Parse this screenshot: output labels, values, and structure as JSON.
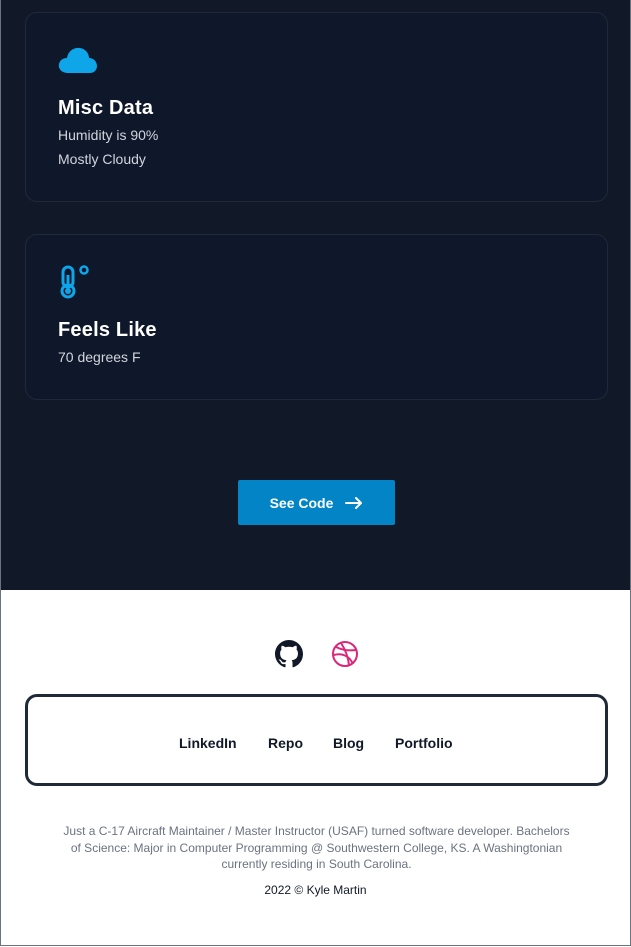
{
  "cards": [
    {
      "icon": "cloud-icon",
      "title": "Misc Data",
      "lines": [
        "Humidity is 90%",
        "Mostly Cloudy"
      ]
    },
    {
      "icon": "thermometer-icon",
      "title": "Feels Like",
      "lines": [
        "70 degrees F"
      ]
    }
  ],
  "see_code": {
    "label": "See Code",
    "icon": "arrow-right-icon"
  },
  "social": [
    {
      "icon": "github-icon",
      "color": "#111827"
    },
    {
      "icon": "dribbble-icon",
      "color": "#db2777"
    }
  ],
  "footer_links": [
    "LinkedIn",
    "Repo",
    "Blog",
    "Portfolio"
  ],
  "about": "Just a C-17 Aircraft Maintainer / Master Instructor (USAF) turned software developer. Bachelors of Science: Major in Computer Programming @ Southwestern College, KS. A Washingtonian currently residing in South Carolina.",
  "copyright": "2022 © Kyle Martin",
  "colors": {
    "dark_bg": "#111827",
    "accent": "#0284c7",
    "icon_blue": "#0ea5e9"
  }
}
